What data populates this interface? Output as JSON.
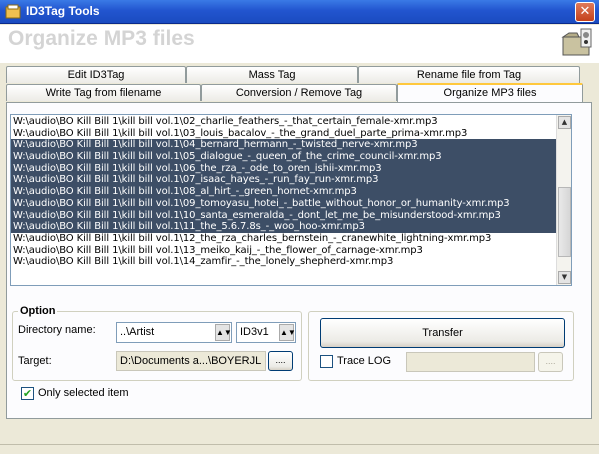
{
  "window": {
    "title": "ID3Tag Tools",
    "close_label": "✕"
  },
  "header": {
    "title": "Organize MP3 files"
  },
  "tabs_row1": [
    {
      "label": "Edit ID3Tag"
    },
    {
      "label": "Mass Tag"
    },
    {
      "label": "Rename file from Tag"
    }
  ],
  "tabs_row2": [
    {
      "label": "Write Tag from filename"
    },
    {
      "label": "Conversion / Remove Tag"
    },
    {
      "label": "Organize MP3 files",
      "active": true
    }
  ],
  "file_list": [
    {
      "path": "W:\\audio\\BO Kill Bill 1\\kill bill vol.1\\02_charlie_feathers_-_that_certain_female-xmr.mp3",
      "selected": false
    },
    {
      "path": "W:\\audio\\BO Kill Bill 1\\kill bill vol.1\\03_louis_bacalov_-_the_grand_duel_parte_prima-xmr.mp3",
      "selected": false
    },
    {
      "path": "W:\\audio\\BO Kill Bill 1\\kill bill vol.1\\04_bernard_hermann_-_twisted_nerve-xmr.mp3",
      "selected": true
    },
    {
      "path": "W:\\audio\\BO Kill Bill 1\\kill bill vol.1\\05_dialogue_-_queen_of_the_crime_council-xmr.mp3",
      "selected": true
    },
    {
      "path": "W:\\audio\\BO Kill Bill 1\\kill bill vol.1\\06_the_rza_-_ode_to_oren_ishii-xmr.mp3",
      "selected": true
    },
    {
      "path": "W:\\audio\\BO Kill Bill 1\\kill bill vol.1\\07_isaac_hayes_-_run_fay_run-xmr.mp3",
      "selected": true
    },
    {
      "path": "W:\\audio\\BO Kill Bill 1\\kill bill vol.1\\08_al_hirt_-_green_hornet-xmr.mp3",
      "selected": true
    },
    {
      "path": "W:\\audio\\BO Kill Bill 1\\kill bill vol.1\\09_tomoyasu_hotei_-_battle_without_honor_or_humanity-xmr.mp3",
      "selected": true
    },
    {
      "path": "W:\\audio\\BO Kill Bill 1\\kill bill vol.1\\10_santa_esmeralda_-_dont_let_me_be_misunderstood-xmr.mp3",
      "selected": true
    },
    {
      "path": "W:\\audio\\BO Kill Bill 1\\kill bill vol.1\\11_the_5.6.7.8s_-_woo_hoo-xmr.mp3",
      "selected": true
    },
    {
      "path": "W:\\audio\\BO Kill Bill 1\\kill bill vol.1\\12_the_rza_charles_bernstein_-_cranewhite_lightning-xmr.mp3",
      "selected": false
    },
    {
      "path": "W:\\audio\\BO Kill Bill 1\\kill bill vol.1\\13_meiko_kaij_-_the_flower_of_carnage-xmr.mp3",
      "selected": false
    },
    {
      "path": "W:\\audio\\BO Kill Bill 1\\kill bill vol.1\\14_zamfir_-_the_lonely_shepherd-xmr.mp3",
      "selected": false
    }
  ],
  "option": {
    "group_label": "Option",
    "directory_name_label": "Directory name:",
    "directory_name_value": "..\\Artist",
    "tag_version_value": "ID3v1",
    "target_label": "Target:",
    "target_value": "D:\\Documents a...\\BOYERJL",
    "browse_label": "...."
  },
  "actions": {
    "transfer_label": "Transfer",
    "trace_log_label": "Trace LOG",
    "trace_log_checked": false,
    "trace_log_path": "",
    "trace_browse_label": "...."
  },
  "only_selected": {
    "label": "Only selected item",
    "checked": true
  },
  "colors": {
    "selection": "#3d4e66",
    "titlebar": "#2255cf",
    "active_tab_accent": "#ffc83c"
  }
}
